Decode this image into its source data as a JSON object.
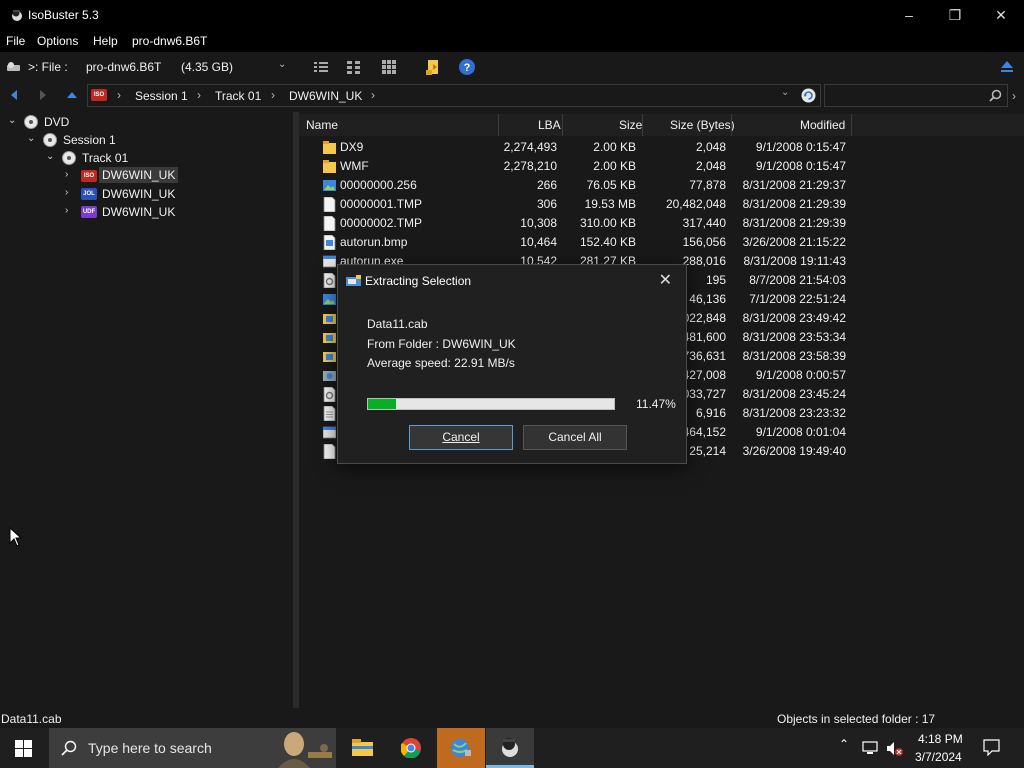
{
  "window": {
    "title": "IsoBuster 5.3"
  },
  "menu": {
    "items": [
      "File",
      "Options",
      "Help",
      "pro-dnw6.B6T"
    ]
  },
  "toolbar": {
    "drive_label": ">: File :",
    "drive_name": "pro-dnw6.B6T",
    "drive_size": "(4.35 GB)"
  },
  "address": {
    "crumbs": [
      "Session 1",
      "Track 01",
      "DW6WIN_UK"
    ]
  },
  "tree": {
    "nodes": [
      {
        "label": "DVD"
      },
      {
        "label": "Session 1"
      },
      {
        "label": "Track 01"
      },
      {
        "label": "DW6WIN_UK",
        "badge": "ISO",
        "badge_color": "#c0281f"
      },
      {
        "label": "DW6WIN_UK",
        "badge": "JOL",
        "badge_color": "#2a4fc0"
      },
      {
        "label": "DW6WIN_UK",
        "badge": "UDF",
        "badge_color": "#7a3bd0"
      }
    ]
  },
  "list": {
    "columns": [
      "Name",
      "LBA",
      "Size",
      "Size (Bytes)",
      "Modified"
    ],
    "rows": [
      {
        "name": "DX9",
        "lba": "2,274,493",
        "size": "2.00 KB",
        "bytes": "2,048",
        "modified": "9/1/2008 0:15:47",
        "icon": "folder-icon"
      },
      {
        "name": "WMF",
        "lba": "2,278,210",
        "size": "2.00 KB",
        "bytes": "2,048",
        "modified": "9/1/2008 0:15:47",
        "icon": "folder-icon"
      },
      {
        "name": "00000000.256",
        "lba": "266",
        "size": "76.05 KB",
        "bytes": "77,878",
        "modified": "8/31/2008 21:29:37",
        "icon": "image-file-icon"
      },
      {
        "name": "00000001.TMP",
        "lba": "306",
        "size": "19.53 MB",
        "bytes": "20,482,048",
        "modified": "8/31/2008 21:29:39",
        "icon": "file-icon"
      },
      {
        "name": "00000002.TMP",
        "lba": "10,308",
        "size": "310.00 KB",
        "bytes": "317,440",
        "modified": "8/31/2008 21:29:39",
        "icon": "file-icon"
      },
      {
        "name": "autorun.bmp",
        "lba": "10,464",
        "size": "152.40 KB",
        "bytes": "156,056",
        "modified": "3/26/2008 21:15:22",
        "icon": "bitmap-file-icon"
      },
      {
        "name": "autorun.exe",
        "lba": "10,542",
        "size": "281.27 KB",
        "bytes": "288,016",
        "modified": "8/31/2008 19:11:43",
        "icon": "exe-file-icon"
      },
      {
        "name": "",
        "lba": "",
        "size": "",
        "bytes": "195",
        "modified": "8/7/2008 21:54:03",
        "icon": "settings-file-icon"
      },
      {
        "name": "",
        "lba": "",
        "size": "",
        "bytes": "46,136",
        "modified": "7/1/2008 22:51:24",
        "icon": "image-file-icon"
      },
      {
        "name": "",
        "lba": "",
        "size": "",
        "bytes": "022,848",
        "modified": "8/31/2008 23:49:42",
        "icon": "cab-file-icon"
      },
      {
        "name": "",
        "lba": "",
        "size": "",
        "bytes": "481,600",
        "modified": "8/31/2008 23:53:34",
        "icon": "cab-file-icon"
      },
      {
        "name": "",
        "lba": "",
        "size": "",
        "bytes": "736,631",
        "modified": "8/31/2008 23:58:39",
        "icon": "cab-file-icon"
      },
      {
        "name": "",
        "lba": "",
        "size": "",
        "bytes": "427,008",
        "modified": "9/1/2008 0:00:57",
        "icon": "installer-file-icon"
      },
      {
        "name": "",
        "lba": "",
        "size": "",
        "bytes": "033,727",
        "modified": "8/31/2008 23:45:24",
        "icon": "settings-file-icon"
      },
      {
        "name": "",
        "lba": "",
        "size": "",
        "bytes": "6,916",
        "modified": "8/31/2008 23:23:32",
        "icon": "text-file-icon"
      },
      {
        "name": "",
        "lba": "",
        "size": "",
        "bytes": "464,152",
        "modified": "9/1/2008 0:01:04",
        "icon": "exe-file-icon"
      },
      {
        "name": "",
        "lba": "",
        "size": "",
        "bytes": "25,214",
        "modified": "3/26/2008 19:49:40",
        "icon": "file-icon"
      }
    ]
  },
  "dialog": {
    "title": "Extracting Selection",
    "file": "Data11.cab",
    "from_folder": "From Folder : DW6WIN_UK",
    "speed": "Average speed: 22.91 MB/s",
    "progress_fraction": 0.1147,
    "progress_label": "11.47%",
    "cancel_label": "Cancel",
    "cancel_all_label": "Cancel All"
  },
  "status": {
    "left": "Data11.cab",
    "right": "Objects in selected folder : 17"
  },
  "taskbar": {
    "search_placeholder": "Type here to search",
    "time": "4:18 PM",
    "date": "3/7/2024"
  }
}
